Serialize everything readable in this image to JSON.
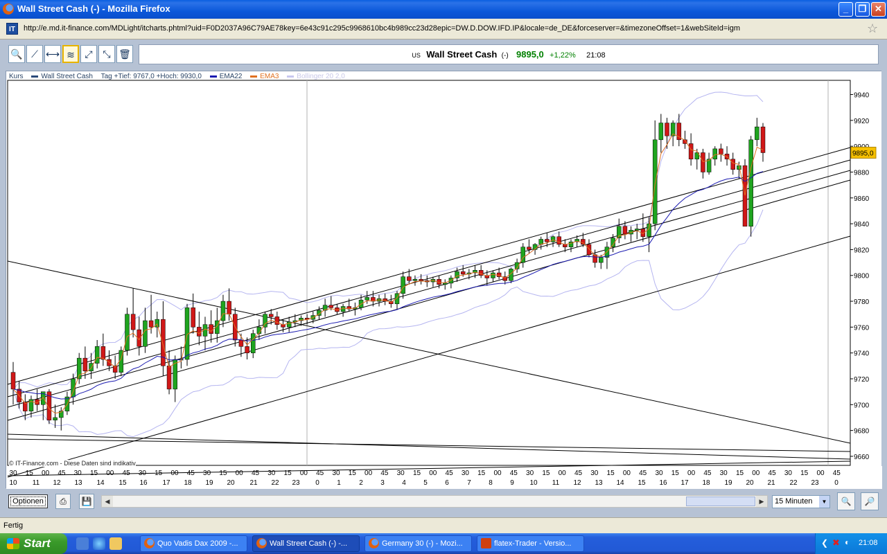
{
  "window": {
    "title": "Wall Street Cash (-) - Mozilla Firefox"
  },
  "urlbar": {
    "site_icon": "IT",
    "url": "http://e.md.it-finance.com/MDLight/itcharts.phtml?uid=F0D2037A96C79AE78key=6e43c91c295c9968610bc4b989cc23d28epic=DW.D.DOW.IFD.IP&locale=de_DE&forceserver=&timezoneOffset=1&webSiteId=igm"
  },
  "toolbar": {
    "tools": [
      {
        "icon": "zoom-tool-icon",
        "glyph": "🔍"
      },
      {
        "icon": "trendline-tool-icon",
        "glyph": "⟋"
      },
      {
        "icon": "horizontal-line-tool-icon",
        "glyph": "⟷"
      },
      {
        "icon": "indicator-tool-icon",
        "glyph": "≋"
      },
      {
        "icon": "channel-tool-icon",
        "glyph": "⤢"
      },
      {
        "icon": "fibonacci-tool-icon",
        "glyph": "⤡"
      },
      {
        "icon": "trash-icon",
        "glyph": "🗑"
      }
    ]
  },
  "quote": {
    "country": "US",
    "name": "Wall Street Cash",
    "change_symbol": "(-)",
    "price": "9895,0",
    "change_pct": "+1,22%",
    "time": "21:08"
  },
  "legend": {
    "kurs": "Kurs",
    "series": "Wall Street Cash",
    "info": "Tag +Tief: 9767,0 +Hoch: 9930,0",
    "ema22": "EMA22",
    "ema3": "EMA3",
    "bollinger": "Bollinger 20 2,0"
  },
  "copyright": "© IT-Finance.com - Diese Daten sind indikativ",
  "colors": {
    "up": "#1FA41F",
    "down": "#D01818",
    "ema22": "#1A1AB0",
    "ema3": "#E07020",
    "bollinger": "#B4B4F0",
    "price_tag": "#F6C000"
  },
  "chart_data": {
    "type": "candlestick",
    "title": "Wall Street Cash",
    "ylim": [
      9653,
      9951
    ],
    "y_ticks": [
      "9940",
      "9920",
      "9900",
      "9880",
      "9860",
      "9840",
      "9820",
      "9800",
      "9780",
      "9760",
      "9740",
      "9720",
      "9700",
      "9680",
      "9660"
    ],
    "last_price_label": "9895,0",
    "x_minutes": [
      "30",
      "15",
      "00",
      "45",
      "30",
      "15",
      "00",
      "45",
      "30",
      "15",
      "00",
      "45",
      "30",
      "15",
      "00",
      "45",
      "30",
      "15",
      "00",
      "45",
      "30",
      "15",
      "00",
      "45",
      "30",
      "15",
      "00",
      "45",
      "30",
      "15",
      "00",
      "45",
      "30",
      "15",
      "00",
      "45",
      "30",
      "15",
      "00",
      "45",
      "30",
      "15",
      "00",
      "45",
      "30",
      "15",
      "00",
      "45",
      "30",
      "15",
      "00",
      "45",
      "30",
      "15",
      "00",
      "45",
      "30",
      "15",
      "00",
      "45",
      "30",
      "15",
      "00",
      "45",
      "30",
      "15",
      "00",
      "45",
      "30",
      "15",
      "00",
      "45",
      "30",
      "15",
      "00",
      "45",
      "30",
      "15",
      "00",
      "45",
      "30",
      "15",
      "00",
      "45",
      "30",
      "15",
      "00",
      "45",
      "30",
      "15",
      "00",
      "45",
      "30",
      "15",
      "00",
      "45",
      "30",
      "15",
      "00",
      "45",
      "30",
      "15",
      "00",
      "45"
    ],
    "x_hours": [
      "10",
      "11",
      "12",
      "13",
      "14",
      "15",
      "16",
      "17",
      "18",
      "19",
      "20",
      "21",
      "22",
      "23",
      "0",
      "1",
      "2",
      "3",
      "4",
      "5",
      "6",
      "7",
      "8",
      "9",
      "10",
      "11",
      "12",
      "13",
      "14",
      "15",
      "16",
      "17",
      "18",
      "19",
      "20",
      "21",
      "22",
      "23",
      "0"
    ],
    "ohlc": [
      [
        9725,
        9733,
        9700,
        9712
      ],
      [
        9712,
        9718,
        9697,
        9702
      ],
      [
        9702,
        9708,
        9688,
        9695
      ],
      [
        9695,
        9707,
        9690,
        9704
      ],
      [
        9704,
        9712,
        9695,
        9700
      ],
      [
        9700,
        9710,
        9688,
        9710
      ],
      [
        9710,
        9712,
        9685,
        9688
      ],
      [
        9688,
        9700,
        9682,
        9690
      ],
      [
        9690,
        9698,
        9680,
        9695
      ],
      [
        9695,
        9710,
        9692,
        9706
      ],
      [
        9706,
        9724,
        9700,
        9720
      ],
      [
        9720,
        9740,
        9716,
        9736
      ],
      [
        9736,
        9745,
        9720,
        9726
      ],
      [
        9726,
        9740,
        9720,
        9732
      ],
      [
        9732,
        9750,
        9728,
        9745
      ],
      [
        9745,
        9755,
        9730,
        9735
      ],
      [
        9735,
        9742,
        9726,
        9730
      ],
      [
        9730,
        9738,
        9720,
        9725
      ],
      [
        9725,
        9745,
        9722,
        9742
      ],
      [
        9742,
        9775,
        9738,
        9770
      ],
      [
        9770,
        9790,
        9752,
        9758
      ],
      [
        9758,
        9768,
        9738,
        9745
      ],
      [
        9745,
        9775,
        9740,
        9765
      ],
      [
        9765,
        9785,
        9755,
        9760
      ],
      [
        9760,
        9772,
        9752,
        9766
      ],
      [
        9766,
        9780,
        9722,
        9730
      ],
      [
        9730,
        9742,
        9708,
        9712
      ],
      [
        9712,
        9738,
        9702,
        9735
      ],
      [
        9735,
        9745,
        9728,
        9735
      ],
      [
        9735,
        9778,
        9730,
        9775
      ],
      [
        9775,
        9786,
        9755,
        9760
      ],
      [
        9760,
        9772,
        9746,
        9753
      ],
      [
        9753,
        9768,
        9742,
        9762
      ],
      [
        9762,
        9773,
        9748,
        9755
      ],
      [
        9755,
        9775,
        9748,
        9765
      ],
      [
        9765,
        9785,
        9760,
        9780
      ],
      [
        9780,
        9790,
        9765,
        9770
      ],
      [
        9770,
        9775,
        9745,
        9750
      ],
      [
        9750,
        9755,
        9737,
        9745
      ],
      [
        9745,
        9752,
        9735,
        9740
      ],
      [
        9740,
        9758,
        9736,
        9755
      ],
      [
        9755,
        9766,
        9750,
        9760
      ],
      [
        9760,
        9772,
        9755,
        9770
      ],
      [
        9770,
        9774,
        9762,
        9768
      ],
      [
        9768,
        9772,
        9758,
        9762
      ],
      [
        9762,
        9766,
        9756,
        9760
      ],
      [
        9760,
        9768,
        9756,
        9764
      ],
      [
        9764,
        9770,
        9760,
        9765
      ],
      [
        9765,
        9769,
        9761,
        9767
      ],
      [
        9767,
        9770,
        9762,
        9766
      ],
      [
        9766,
        9772,
        9763,
        9769
      ],
      [
        9769,
        9776,
        9766,
        9773
      ],
      [
        9773,
        9782,
        9768,
        9777
      ],
      [
        9777,
        9784,
        9773,
        9775
      ],
      [
        9775,
        9778,
        9770,
        9772
      ],
      [
        9772,
        9778,
        9768,
        9776
      ],
      [
        9776,
        9782,
        9772,
        9774
      ],
      [
        9774,
        9779,
        9769,
        9775
      ],
      [
        9775,
        9785,
        9773,
        9781
      ],
      [
        9781,
        9788,
        9778,
        9783
      ],
      [
        9783,
        9788,
        9776,
        9780
      ],
      [
        9780,
        9785,
        9776,
        9782
      ],
      [
        9782,
        9786,
        9777,
        9780
      ],
      [
        9780,
        9785,
        9775,
        9778
      ],
      [
        9778,
        9788,
        9774,
        9786
      ],
      [
        9786,
        9803,
        9782,
        9799
      ],
      [
        9799,
        9805,
        9793,
        9796
      ],
      [
        9796,
        9800,
        9792,
        9797
      ],
      [
        9797,
        9801,
        9793,
        9796
      ],
      [
        9796,
        9800,
        9791,
        9795
      ],
      [
        9795,
        9799,
        9791,
        9797
      ],
      [
        9797,
        9800,
        9790,
        9793
      ],
      [
        9793,
        9797,
        9789,
        9794
      ],
      [
        9794,
        9800,
        9790,
        9798
      ],
      [
        9798,
        9806,
        9795,
        9803
      ],
      [
        9803,
        9808,
        9799,
        9801
      ],
      [
        9801,
        9805,
        9797,
        9802
      ],
      [
        9802,
        9808,
        9798,
        9804
      ],
      [
        9804,
        9808,
        9798,
        9800
      ],
      [
        9800,
        9804,
        9792,
        9798
      ],
      [
        9798,
        9804,
        9795,
        9802
      ],
      [
        9802,
        9806,
        9797,
        9799
      ],
      [
        9799,
        9803,
        9793,
        9796
      ],
      [
        9796,
        9806,
        9794,
        9805
      ],
      [
        9805,
        9813,
        9802,
        9810
      ],
      [
        9810,
        9825,
        9806,
        9822
      ],
      [
        9822,
        9828,
        9817,
        9820
      ],
      [
        9820,
        9825,
        9816,
        9824
      ],
      [
        9824,
        9830,
        9820,
        9828
      ],
      [
        9828,
        9833,
        9822,
        9826
      ],
      [
        9826,
        9831,
        9822,
        9830
      ],
      [
        9830,
        9834,
        9822,
        9824
      ],
      [
        9824,
        9828,
        9818,
        9822
      ],
      [
        9822,
        9828,
        9818,
        9826
      ],
      [
        9826,
        9831,
        9822,
        9828
      ],
      [
        9828,
        9833,
        9822,
        9824
      ],
      [
        9824,
        9828,
        9814,
        9816
      ],
      [
        9816,
        9820,
        9806,
        9810
      ],
      [
        9810,
        9816,
        9805,
        9814
      ],
      [
        9814,
        9826,
        9805,
        9822
      ],
      [
        9822,
        9832,
        9818,
        9829
      ],
      [
        9829,
        9844,
        9825,
        9838
      ],
      [
        9838,
        9842,
        9828,
        9832
      ],
      [
        9832,
        9838,
        9826,
        9835
      ],
      [
        9835,
        9840,
        9828,
        9836
      ],
      [
        9836,
        9848,
        9826,
        9830
      ],
      [
        9830,
        9845,
        9818,
        9840
      ],
      [
        9840,
        9920,
        9835,
        9905
      ],
      [
        9905,
        9925,
        9895,
        9918
      ],
      [
        9918,
        9922,
        9898,
        9908
      ],
      [
        9908,
        9920,
        9900,
        9918
      ],
      [
        9918,
        9925,
        9900,
        9905
      ],
      [
        9905,
        9912,
        9898,
        9902
      ],
      [
        9902,
        9910,
        9885,
        9890
      ],
      [
        9890,
        9898,
        9882,
        9895
      ],
      [
        9895,
        9898,
        9875,
        9880
      ],
      [
        9880,
        9895,
        9878,
        9890
      ],
      [
        9890,
        9900,
        9885,
        9898
      ],
      [
        9898,
        9902,
        9888,
        9894
      ],
      [
        9894,
        9900,
        9885,
        9890
      ],
      [
        9890,
        9895,
        9878,
        9882
      ],
      [
        9882,
        9888,
        9875,
        9885
      ],
      [
        9885,
        9890,
        9860,
        9838
      ],
      [
        9838,
        9908,
        9830,
        9905
      ],
      [
        9905,
        9922,
        9900,
        9915
      ],
      [
        9915,
        9918,
        9888,
        9895
      ]
    ],
    "overlays": [
      {
        "name": "EMA22",
        "color": "#1A1AB0"
      },
      {
        "name": "EMA3",
        "color": "#E07020"
      },
      {
        "name": "Bollinger 20 2,0",
        "color": "#B4B4F0"
      }
    ]
  },
  "bottom": {
    "options_label": "Optionen",
    "interval": "15 Minuten"
  },
  "status": {
    "text": "Fertig"
  },
  "taskbar": {
    "start": "Start",
    "tasks": [
      {
        "label": "Quo Vadis Dax 2009 -...",
        "active": false
      },
      {
        "label": "Wall Street Cash (-) -...",
        "active": true
      },
      {
        "label": "Germany 30 (-) - Mozi...",
        "active": false
      },
      {
        "label": "flatex-Trader - Versio...",
        "active": false
      }
    ],
    "clock": "21:08"
  }
}
